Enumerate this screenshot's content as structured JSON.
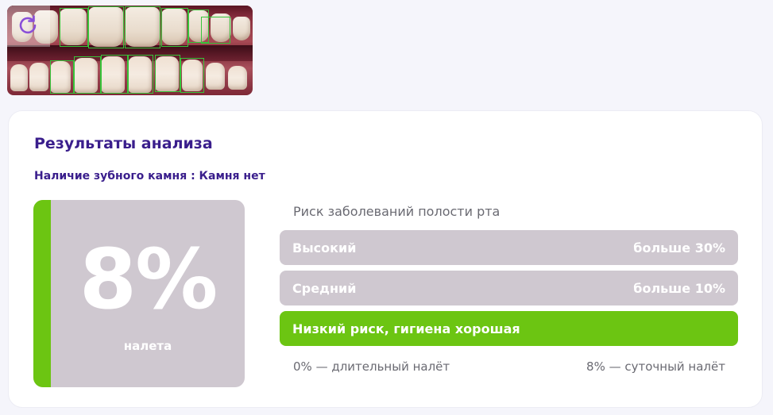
{
  "photo": {
    "refresh_icon": "refresh-icon",
    "accent_color": "#37c43a"
  },
  "results": {
    "title": "Результаты анализа",
    "tartar": "Наличие зубного камня : Камня нет",
    "plaque": {
      "value": "8%",
      "label": "налета",
      "level": 0.08,
      "color": "#6cc512"
    },
    "risk": {
      "title": "Риск заболеваний полости рта",
      "levels": [
        {
          "label": "Высокий",
          "value": "больше 30%",
          "active": false
        },
        {
          "label": "Средний",
          "value": "больше 10%",
          "active": false
        },
        {
          "label": "Низкий риск, гигиена хорошая",
          "value": "",
          "active": true
        }
      ],
      "scale_left": "0% — длительный налёт",
      "scale_right": "8% — суточный налёт"
    },
    "colors": {
      "title": "#3a1e8c",
      "inactive": "#cfc8d0",
      "active": "#6cc512"
    }
  }
}
